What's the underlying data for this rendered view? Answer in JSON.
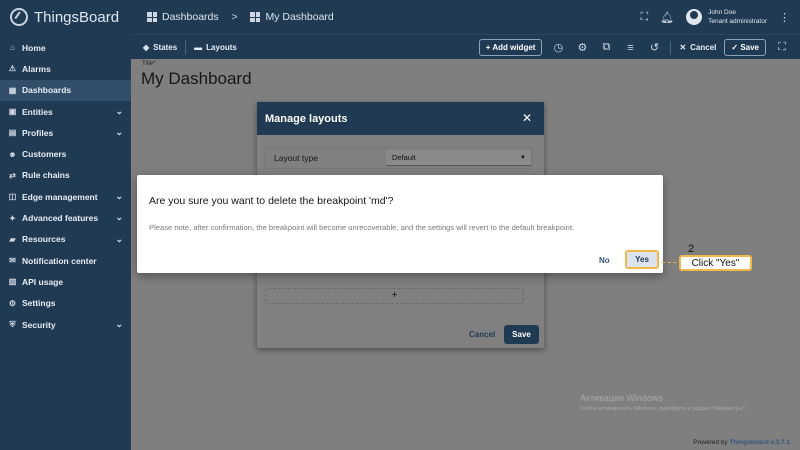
{
  "app": {
    "name": "ThingsBoard"
  },
  "breadcrumb": {
    "dashboards": "Dashboards",
    "separator": ">",
    "current": "My Dashboard"
  },
  "user": {
    "name": "John Doe",
    "role": "Tenant administrator"
  },
  "sidebar": {
    "items": [
      {
        "label": "Home",
        "icon": "home-icon",
        "expandable": false,
        "active": false
      },
      {
        "label": "Alarms",
        "icon": "alarm-icon",
        "expandable": false,
        "active": false
      },
      {
        "label": "Dashboards",
        "icon": "dashboards-icon",
        "expandable": false,
        "active": true
      },
      {
        "label": "Entities",
        "icon": "entities-icon",
        "expandable": true,
        "active": false
      },
      {
        "label": "Profiles",
        "icon": "profiles-icon",
        "expandable": true,
        "active": false
      },
      {
        "label": "Customers",
        "icon": "customers-icon",
        "expandable": false,
        "active": false
      },
      {
        "label": "Rule chains",
        "icon": "rule-chains-icon",
        "expandable": false,
        "active": false
      },
      {
        "label": "Edge management",
        "icon": "edge-icon",
        "expandable": true,
        "active": false
      },
      {
        "label": "Advanced features",
        "icon": "advanced-icon",
        "expandable": true,
        "active": false
      },
      {
        "label": "Resources",
        "icon": "resources-icon",
        "expandable": true,
        "active": false
      },
      {
        "label": "Notification center",
        "icon": "notification-icon",
        "expandable": false,
        "active": false
      },
      {
        "label": "API usage",
        "icon": "api-usage-icon",
        "expandable": false,
        "active": false
      },
      {
        "label": "Settings",
        "icon": "settings-icon",
        "expandable": false,
        "active": false
      },
      {
        "label": "Security",
        "icon": "security-icon",
        "expandable": true,
        "active": false
      }
    ]
  },
  "toolbar": {
    "states": "States",
    "layouts": "Layouts",
    "add_widget": "+ Add widget",
    "cancel": "Cancel",
    "save": "Save"
  },
  "dashboard": {
    "title_label": "Title*",
    "title": "My Dashboard"
  },
  "manage_layouts": {
    "title": "Manage layouts",
    "layout_type_label": "Layout type",
    "layout_type_value": "Default",
    "add_symbol": "+",
    "cancel": "Cancel",
    "save": "Save"
  },
  "confirm_dialog": {
    "title": "Are you sure you want to delete the breakpoint 'md'?",
    "body": "Please note, after confirmation, the breakpoint will become unrecoverable, and the settings will revert to the default breakpoint.",
    "no": "No",
    "yes": "Yes"
  },
  "annotation": {
    "step": "2",
    "text": "Click \"Yes\""
  },
  "watermark": {
    "line1": "Активация Windows",
    "line2": "Чтобы активировать Windows, перейдите в раздел \"Параметры\"."
  },
  "footer": {
    "prefix": "Powered by ",
    "brand": "Thingsboard v.3.7.1"
  },
  "colors": {
    "primary": "#213a54",
    "highlight": "#f0b94a",
    "overlay": "#7f7f7f"
  }
}
